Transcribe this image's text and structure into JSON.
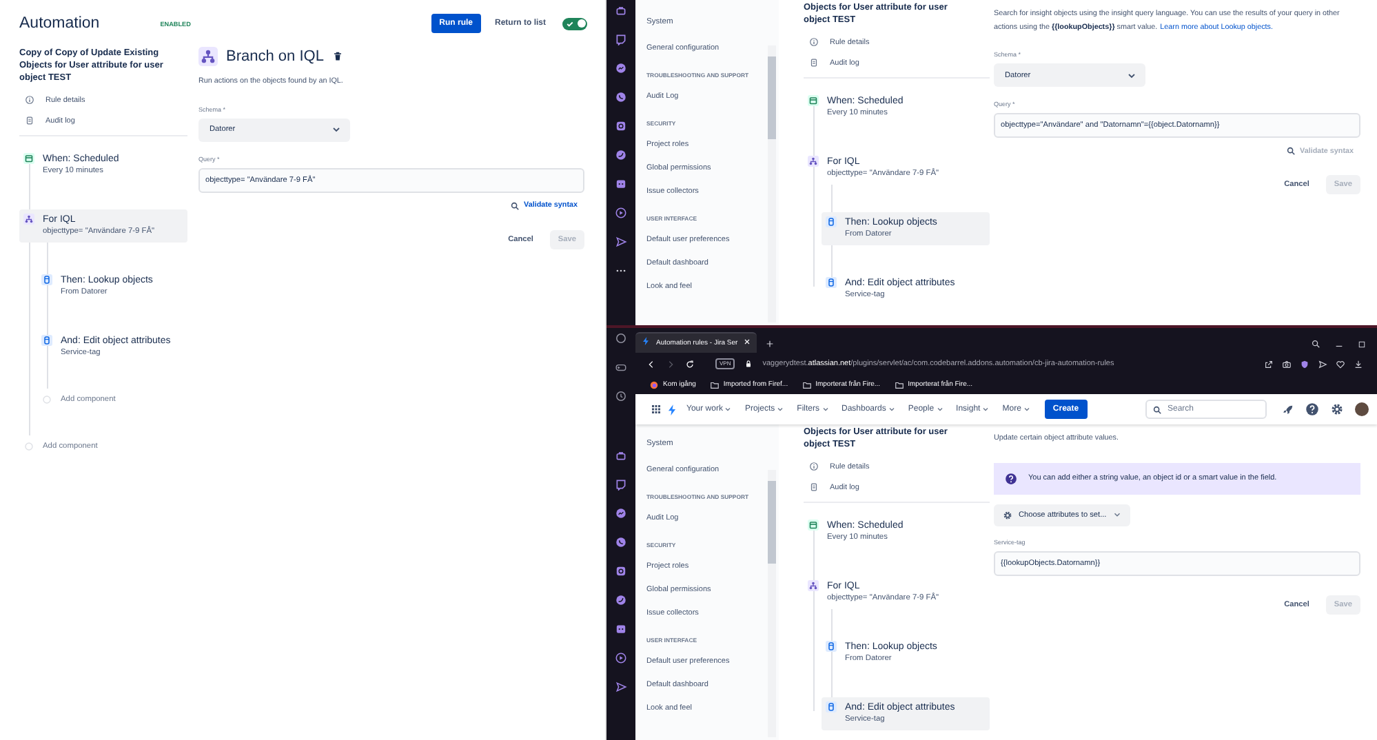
{
  "left_window": {
    "header": {
      "title": "Automation",
      "status": "ENABLED",
      "run_button": "Run rule",
      "return_link": "Return to list",
      "rule_toggle": {
        "on": true
      }
    },
    "rule": {
      "title": "Copy of Copy of Update Existing Objects for User attribute for user object TEST",
      "links": [
        {
          "kind": "details",
          "label": "Rule details"
        },
        {
          "kind": "log",
          "label": "Audit log"
        }
      ],
      "components": [
        {
          "kind": "trigger",
          "title": "When: Scheduled",
          "summary": "Every 10 minutes",
          "selected": false
        },
        {
          "kind": "branch",
          "title": "For IQL",
          "summary": "objecttype= \"Användare 7-9 FÅ\"",
          "selected": true,
          "children": [
            {
              "kind": "action",
              "title": "Then: Lookup objects",
              "summary": "From Datorer",
              "selected": false
            },
            {
              "kind": "action",
              "title": "And: Edit object attributes",
              "summary": "Service-tag",
              "selected": false
            },
            {
              "kind": "add",
              "title": "Add component",
              "selected": false
            }
          ]
        },
        {
          "kind": "add",
          "title": "Add component",
          "selected": false
        }
      ]
    },
    "editor": {
      "kind": "branch",
      "title": "Branch on IQL",
      "blocks": [
        {
          "kind": "description",
          "text": "Run actions on the objects found by an IQL."
        },
        {
          "kind": "select",
          "label": "Schema *",
          "value": "Datorer"
        },
        {
          "kind": "text",
          "label": "Query *",
          "value": "objecttype= \"Användare 7-9 FÅ\""
        },
        {
          "kind": "validate",
          "label": "Validate syntax",
          "disabled": false
        }
      ],
      "cancel": "Cancel",
      "save": {
        "label": "Save",
        "disabled": true
      }
    }
  },
  "top_right_window": {
    "sidebar": {
      "items": [
        {
          "kind": "title",
          "label": "System"
        },
        {
          "kind": "link",
          "label": "General configuration"
        },
        {
          "kind": "heading",
          "label": "TROUBLESHOOTING AND SUPPORT"
        },
        {
          "kind": "link",
          "label": "Audit Log"
        },
        {
          "kind": "heading",
          "label": "SECURITY"
        },
        {
          "kind": "link",
          "label": "Project roles"
        },
        {
          "kind": "link",
          "label": "Global permissions"
        },
        {
          "kind": "link",
          "label": "Issue collectors"
        },
        {
          "kind": "heading",
          "label": "USER INTERFACE"
        },
        {
          "kind": "link",
          "label": "Default user preferences"
        },
        {
          "kind": "link",
          "label": "Default dashboard"
        },
        {
          "kind": "link",
          "label": "Look and feel"
        }
      ]
    },
    "rule": {
      "title": "Objects for User attribute for user object TEST",
      "links": [
        {
          "kind": "details",
          "label": "Rule details"
        },
        {
          "kind": "log",
          "label": "Audit log"
        }
      ],
      "components": [
        {
          "kind": "trigger",
          "title": "When: Scheduled",
          "summary": "Every 10 minutes",
          "selected": false
        },
        {
          "kind": "branch",
          "title": "For IQL",
          "summary": "objecttype= \"Användare 7-9 FÅ\"",
          "selected": false,
          "children": [
            {
              "kind": "action",
              "title": "Then: Lookup objects",
              "summary": "From Datorer",
              "selected": true
            },
            {
              "kind": "action",
              "title": "And: Edit object attributes",
              "summary": "Service-tag",
              "selected": false
            }
          ]
        }
      ]
    },
    "editor": {
      "blocks": [
        {
          "kind": "description",
          "text": "Search for insight objects using the insight query language. You can use the results of your query in other actions using the **{{lookupObjects}}** smart value.",
          "link": "Learn more about Lookup objects."
        },
        {
          "kind": "select",
          "label": "Schema *",
          "value": "Datorer"
        },
        {
          "kind": "text",
          "label": "Query *",
          "value": "objecttype=\"Användare\" and \"Datornamn\"={{object.Datornamn}}"
        },
        {
          "kind": "validate",
          "label": "Validate syntax",
          "disabled": true
        }
      ],
      "cancel": "Cancel",
      "save": {
        "label": "Save",
        "disabled": true
      }
    }
  },
  "browser": {
    "tab": {
      "title": "Automation rules - Jira Ser",
      "selected": true
    },
    "vpn": "VPN",
    "address": "vaggerydtest.**atlassian.net**/plugins/servlet/ac/com.codebarrel.addons.automation/cb-jira-automation-rules",
    "bookmarks": [
      {
        "kind": "site",
        "label": "Kom igång"
      },
      {
        "kind": "folder",
        "label": "Imported from Firef..."
      },
      {
        "kind": "folder",
        "label": "Importerat från Fire..."
      },
      {
        "kind": "folder",
        "label": "Importerat från Fire..."
      }
    ],
    "nav": {
      "items": [
        "Your work",
        "Projects",
        "Filters",
        "Dashboards",
        "People",
        "Insight",
        "More"
      ],
      "create": "Create",
      "search_placeholder": "Search"
    },
    "sidebar": {
      "items": [
        {
          "kind": "title",
          "label": "System"
        },
        {
          "kind": "link",
          "label": "General configuration"
        },
        {
          "kind": "heading",
          "label": "TROUBLESHOOTING AND SUPPORT"
        },
        {
          "kind": "link",
          "label": "Audit Log"
        },
        {
          "kind": "heading",
          "label": "SECURITY"
        },
        {
          "kind": "link",
          "label": "Project roles"
        },
        {
          "kind": "link",
          "label": "Global permissions"
        },
        {
          "kind": "link",
          "label": "Issue collectors"
        },
        {
          "kind": "heading",
          "label": "USER INTERFACE"
        },
        {
          "kind": "link",
          "label": "Default user preferences"
        },
        {
          "kind": "link",
          "label": "Default dashboard"
        },
        {
          "kind": "link",
          "label": "Look and feel"
        }
      ]
    },
    "rule": {
      "title": "Objects for User attribute for user object TEST",
      "links": [
        {
          "kind": "details",
          "label": "Rule details"
        },
        {
          "kind": "log",
          "label": "Audit log"
        }
      ],
      "components": [
        {
          "kind": "trigger",
          "title": "When: Scheduled",
          "summary": "Every 10 minutes",
          "selected": false
        },
        {
          "kind": "branch",
          "title": "For IQL",
          "summary": "objecttype= \"Användare 7-9 FÅ\"",
          "selected": false,
          "children": [
            {
              "kind": "action",
              "title": "Then: Lookup objects",
              "summary": "From Datorer",
              "selected": false
            },
            {
              "kind": "action",
              "title": "And: Edit object attributes",
              "summary": "Service-tag",
              "selected": true
            }
          ]
        }
      ]
    },
    "editor": {
      "blocks": [
        {
          "kind": "description",
          "text": "Update certain object attribute values."
        },
        {
          "kind": "info",
          "text": "You can add either a string value, an object id or a smart value in the field."
        },
        {
          "kind": "choose",
          "label": "Choose attributes to set..."
        },
        {
          "kind": "text",
          "label": "Service-tag",
          "value": "{{lookupObjects.Datornamn}}"
        }
      ],
      "cancel": "Cancel",
      "save": {
        "label": "Save",
        "disabled": true
      }
    }
  }
}
